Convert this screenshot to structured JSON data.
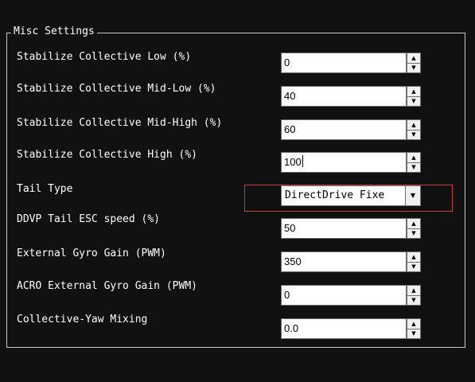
{
  "group": {
    "title": "Misc Settings"
  },
  "fields": [
    {
      "label": "Stabilize Collective Low (%)",
      "value": "0"
    },
    {
      "label": "Stabilize Collective Mid-Low (%)",
      "value": "40"
    },
    {
      "label": "Stabilize Collective Mid-High (%)",
      "value": "60"
    },
    {
      "label": "Stabilize Collective High (%)",
      "value": "100"
    }
  ],
  "tail": {
    "label": "Tail Type",
    "selected": "DirectDrive Fixe"
  },
  "fields2": [
    {
      "label": "DDVP Tail ESC speed (%)",
      "value": "50"
    },
    {
      "label": "External Gyro Gain (PWM)",
      "value": "350"
    },
    {
      "label": "ACRO External Gyro Gain (PWM)",
      "value": "0"
    },
    {
      "label": "Collective-Yaw Mixing",
      "value": "0.0"
    }
  ],
  "colors": {
    "highlight_border": "#d23a3a",
    "panel_bg": "#111111"
  }
}
